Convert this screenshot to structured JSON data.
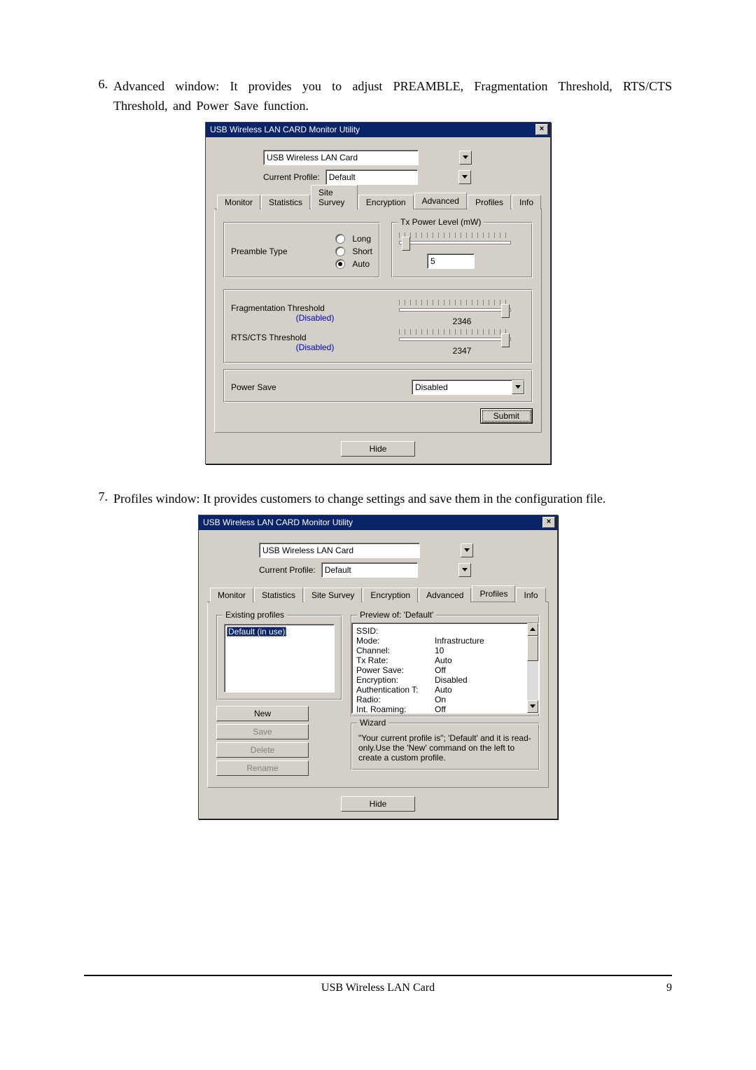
{
  "doc": {
    "item6": {
      "num": "6.",
      "text": "Advanced window: It provides you to adjust PREAMBLE, Fragmentation Threshold, RTS/CTS Threshold, and Power Save function."
    },
    "item7": {
      "num": "7.",
      "text": "Profiles window: It provides customers to change settings and save them in the configuration file."
    },
    "footer_center": "USB Wireless LAN Card",
    "page_num": "9"
  },
  "dlg": {
    "title": "USB Wireless LAN CARD Monitor Utility",
    "card_value": "USB Wireless LAN Card",
    "profile_label": "Current Profile:",
    "profile_value": "Default",
    "tabs": [
      "Monitor",
      "Statistics",
      "Site Survey",
      "Encryption",
      "Advanced",
      "Profiles",
      "Info"
    ],
    "hide": "Hide"
  },
  "adv": {
    "preamble_label": "Preamble Type",
    "opt_long": "Long",
    "opt_short": "Short",
    "opt_auto": "Auto",
    "tx_group": "Tx Power Level (mW)",
    "tx_value": "5",
    "frag_label": "Fragmentation Threshold",
    "frag_status": "(Disabled)",
    "frag_value": "2346",
    "rts_label": "RTS/CTS Threshold",
    "rts_status": "(Disabled)",
    "rts_value": "2347",
    "power_label": "Power Save",
    "power_value": "Disabled",
    "submit": "Submit"
  },
  "prof": {
    "existing_legend": "Existing profiles",
    "existing_item": "Default (in use)",
    "btn_new": "New",
    "btn_save": "Save",
    "btn_delete": "Delete",
    "btn_rename": "Rename",
    "preview_legend": "Preview of: 'Default'",
    "rows": [
      [
        "SSID:",
        ""
      ],
      [
        "Mode:",
        "Infrastructure"
      ],
      [
        "Channel:",
        "10"
      ],
      [
        "Tx Rate:",
        "Auto"
      ],
      [
        "Power Save:",
        "Off"
      ],
      [
        "Encryption:",
        "Disabled"
      ],
      [
        "Authentication T:",
        "Auto"
      ],
      [
        "Radio:",
        "On"
      ],
      [
        "Int. Roaming:",
        "Off"
      ]
    ],
    "wizard_legend": "Wizard",
    "wizard_text": "\"Your current profile is\"; 'Default' and it is read-only.Use the 'New' command on the left to create a custom profile."
  }
}
